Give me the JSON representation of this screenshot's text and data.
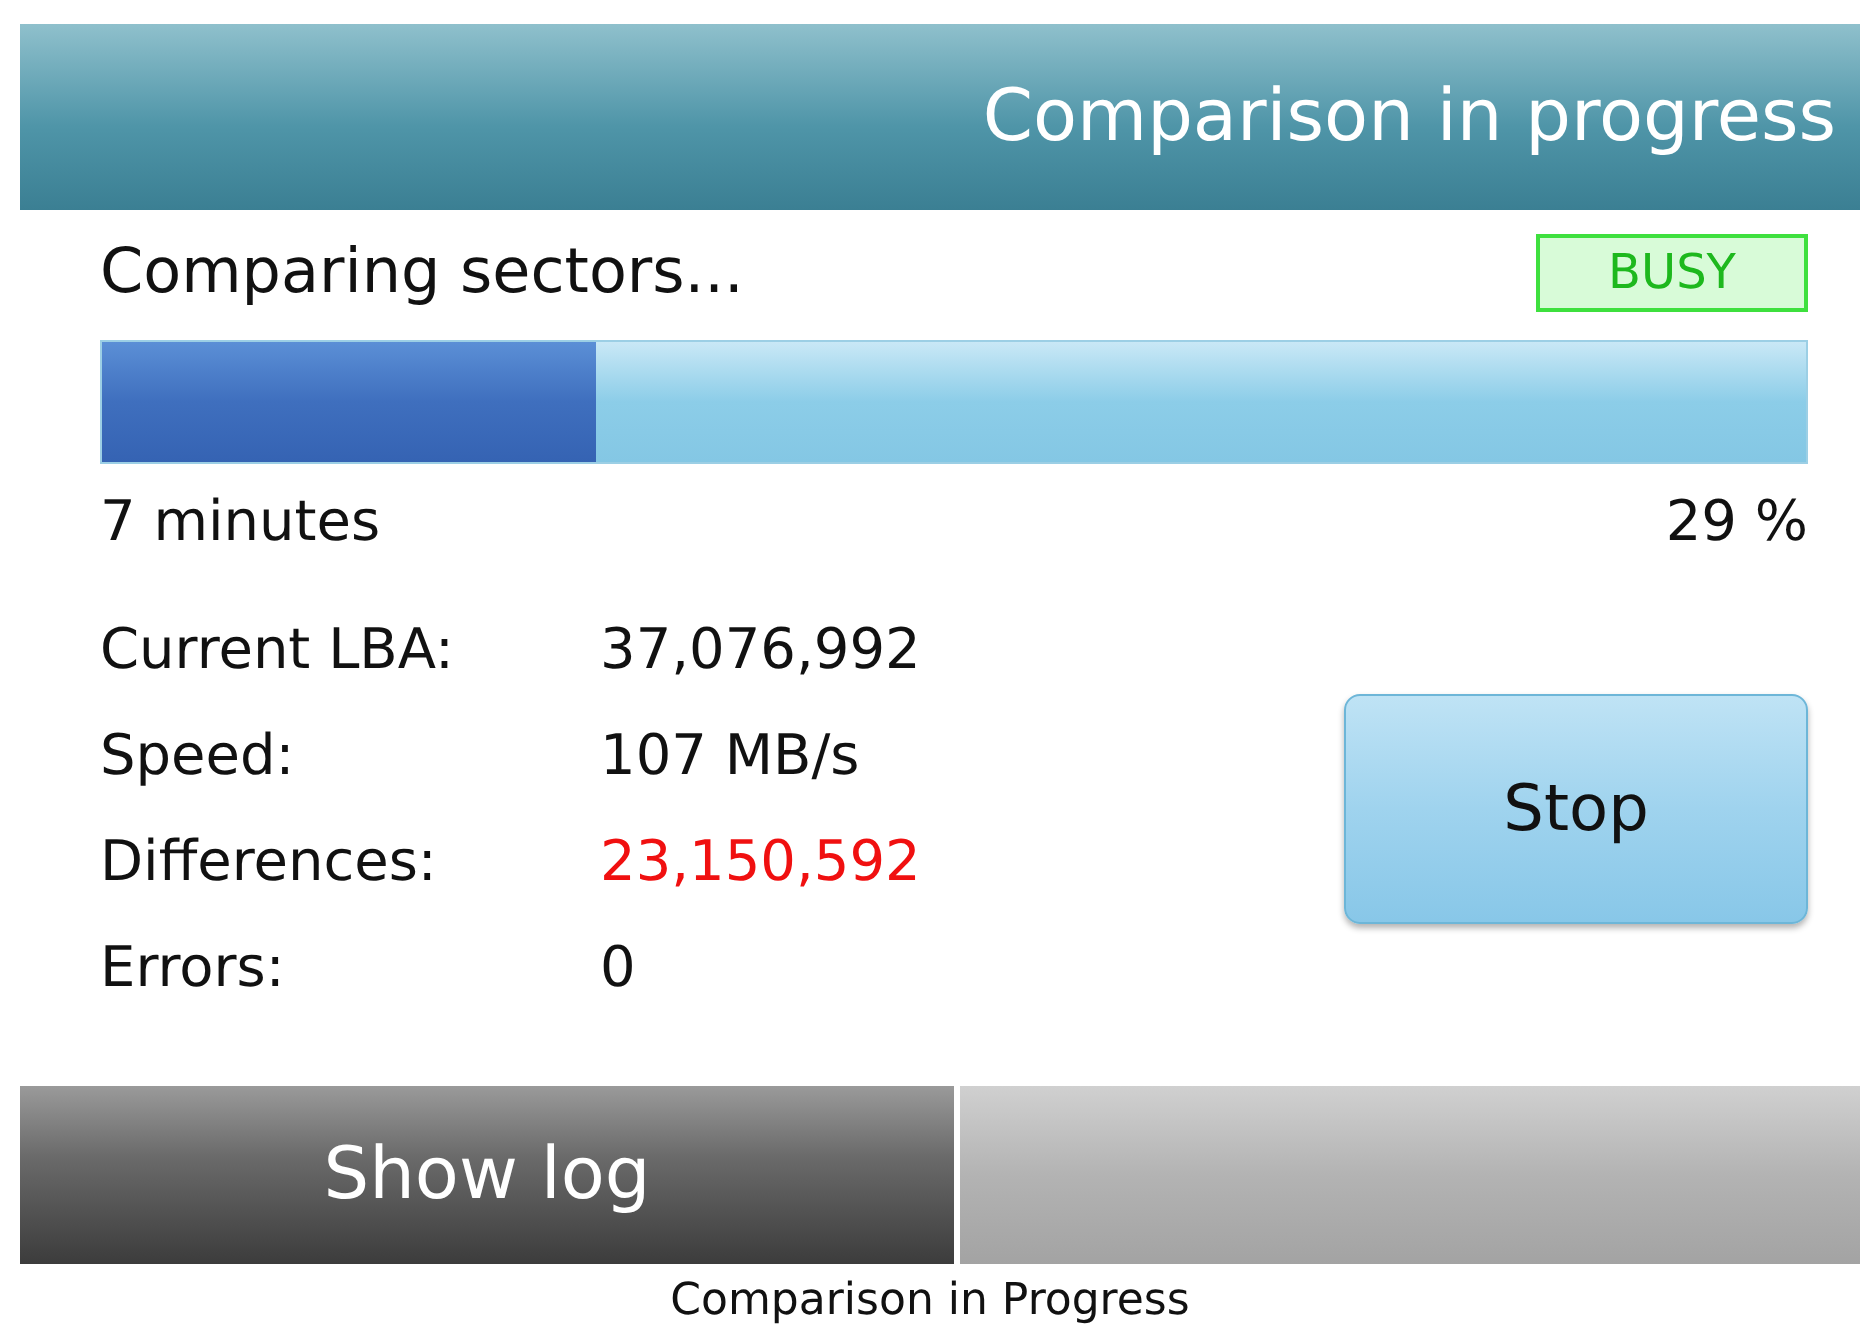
{
  "header": {
    "title": "Comparison in progress"
  },
  "status": {
    "text": "Comparing sectors...",
    "badge": "BUSY"
  },
  "progress": {
    "level": 0.29,
    "remaining": "7 minutes",
    "percent": "29 %"
  },
  "stats": [
    {
      "label": "Current LBA:",
      "value": "37,076,992",
      "kind": "normal"
    },
    {
      "label": "Speed:",
      "value": "107 MB/s",
      "kind": "normal"
    },
    {
      "label": "Differences:",
      "value": "23,150,592",
      "kind": "alert"
    },
    {
      "label": "Errors:",
      "value": "0",
      "kind": "normal"
    }
  ],
  "stop_button": {
    "label": "Stop"
  },
  "bottom_bar": [
    {
      "kind": "button",
      "label": "Show log"
    },
    {
      "kind": "blank"
    }
  ],
  "caption": "Comparison in Progress"
}
